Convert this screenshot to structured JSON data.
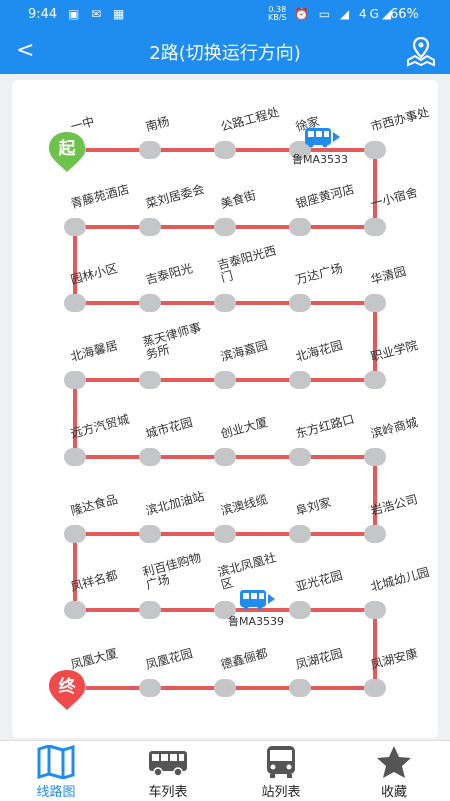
{
  "status_bar": {
    "time": "9:44",
    "speed_value": "0.38",
    "speed_unit": "KB/S",
    "network": "4G",
    "battery": "66%"
  },
  "header": {
    "title": "2路(切换运行方向)",
    "back_icon": "chevron-left-icon",
    "map_icon": "map-pin-icon"
  },
  "route": {
    "start_marker": "起",
    "end_marker": "终",
    "stops": [
      "一中",
      "南杨",
      "公路工程处",
      "徐家",
      "市西办事处",
      "一小宿舍",
      "银座黄河店",
      "美食街",
      "菜刘居委会",
      "青藤苑酒店",
      "园林小区",
      "吉泰阳光",
      "吉泰阳光西门",
      "万达广场",
      "华清园",
      "职业学院",
      "北海花园",
      "滨海嘉园",
      "蒸天律师事务所",
      "北海馨居",
      "远方汽贸城",
      "城市花园",
      "创业大厦",
      "东方红路口",
      "滨岭商城",
      "岩浩公司",
      "阜刘家",
      "滨澳线缆",
      "滨北加油站",
      "隆达食品",
      "凤祥名都",
      "利百佳购物广场",
      "滨北凤凰社区",
      "亚光花园",
      "北城幼儿园",
      "凤湖安康",
      "凤湖花园",
      "德鑫俪都",
      "凤凰花园",
      "凤凰大厦"
    ],
    "buses": [
      {
        "plate": "鲁MA3533"
      },
      {
        "plate": "鲁MA3539"
      }
    ],
    "colors": {
      "line": "#e25a5a",
      "stop": "#c4c6c8",
      "start": "#6cc24a",
      "end": "#f04a4a",
      "bus": "#1f8cf0"
    }
  },
  "tabs": [
    {
      "label": "线路图",
      "icon": "map-book-icon"
    },
    {
      "label": "车列表",
      "icon": "bus-icon"
    },
    {
      "label": "站列表",
      "icon": "bus-front-icon"
    },
    {
      "label": "收藏",
      "icon": "star-icon"
    }
  ]
}
